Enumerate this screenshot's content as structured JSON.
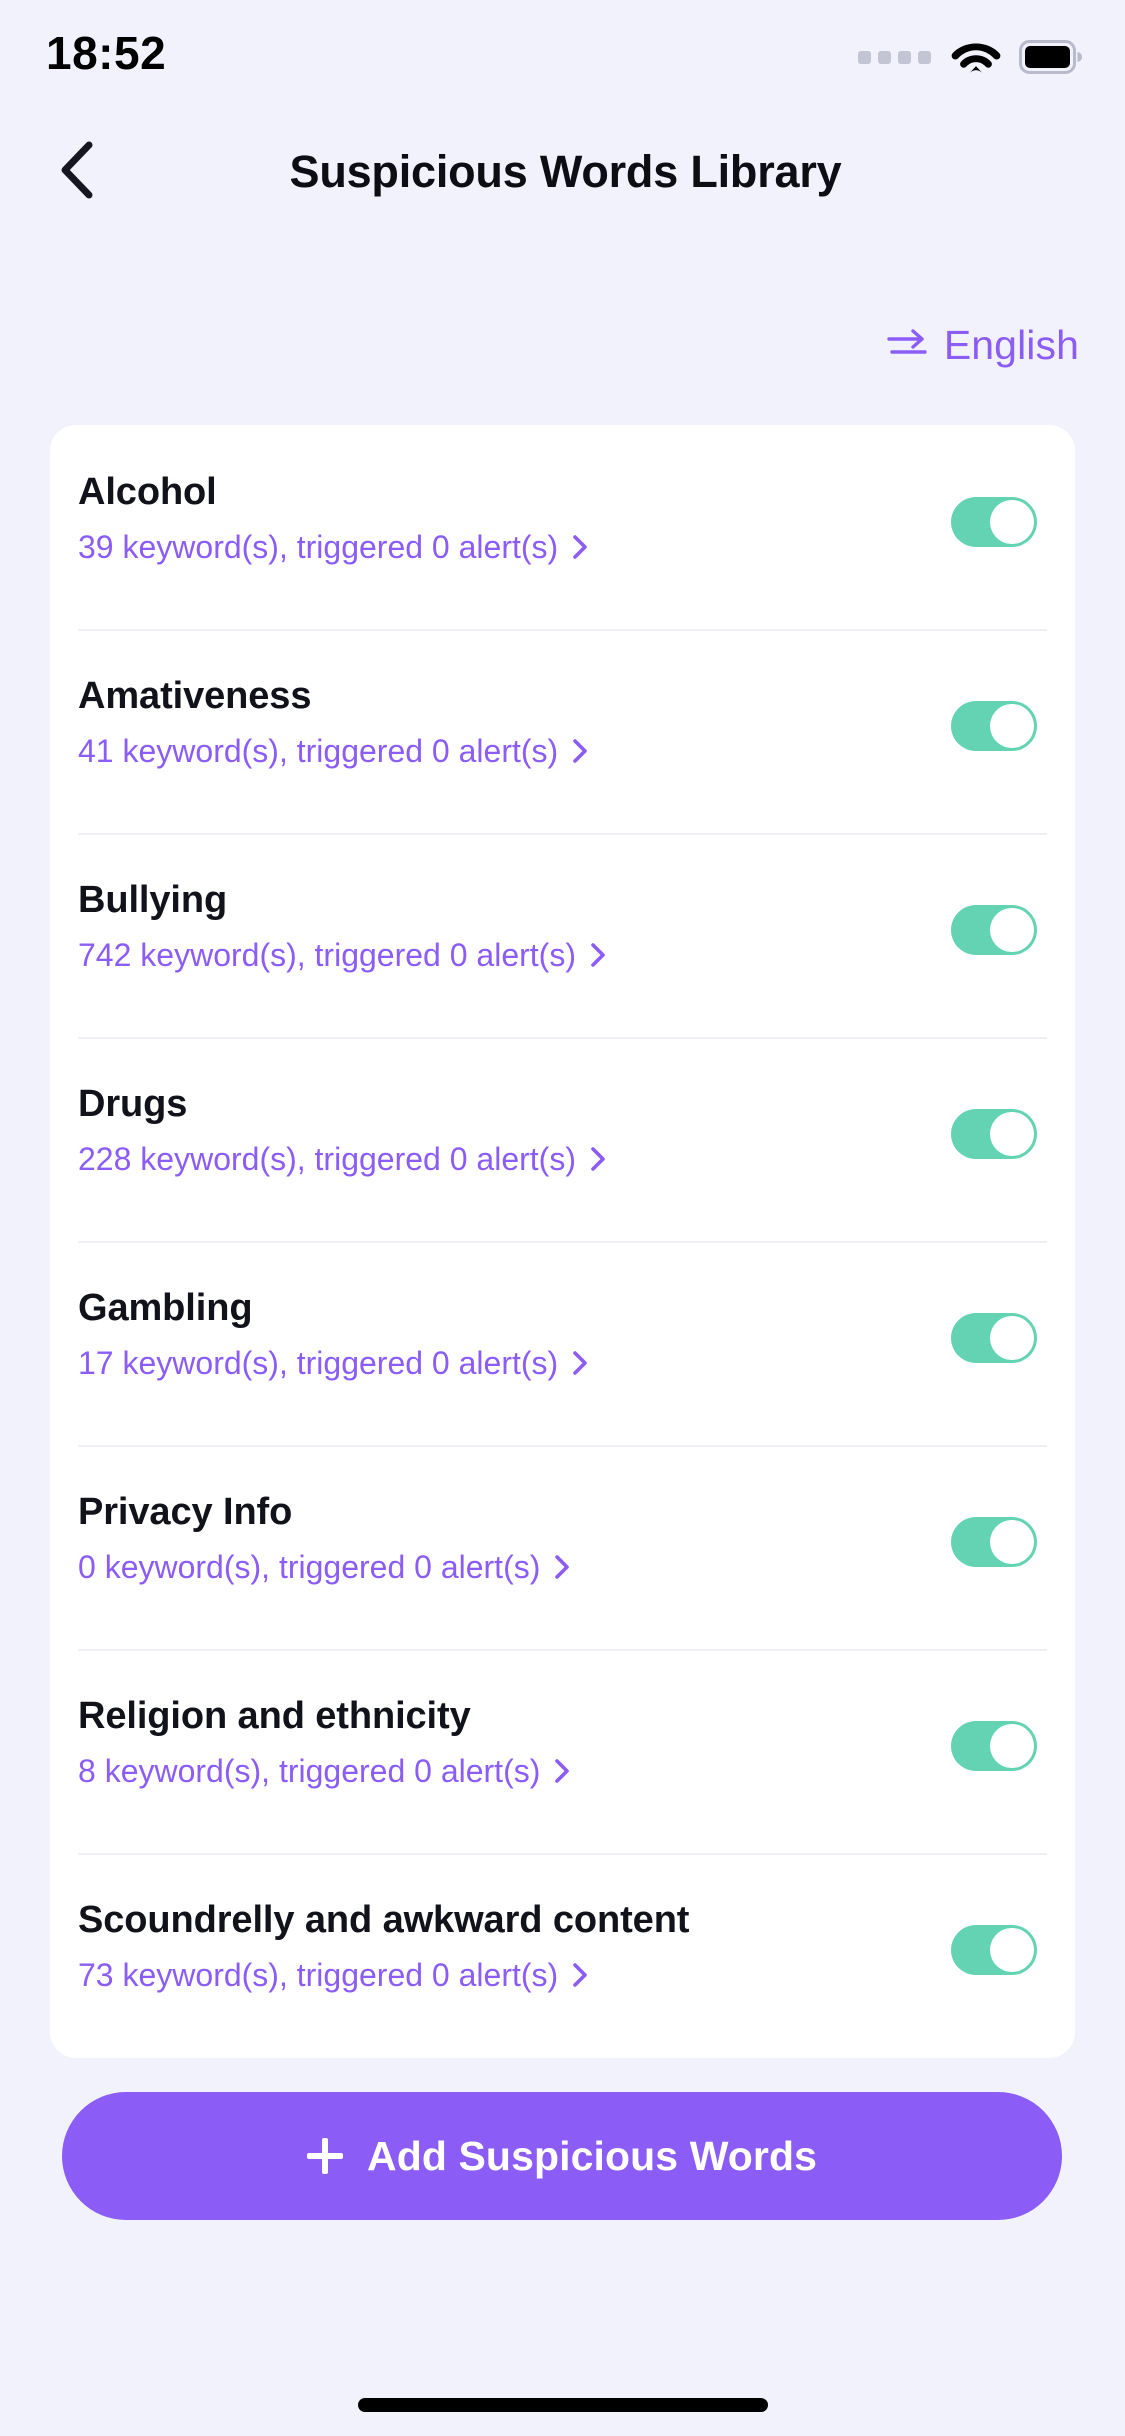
{
  "status_bar": {
    "time": "18:52",
    "signal_icon": "signal-dots-icon",
    "wifi_icon": "wifi-icon",
    "battery_icon": "battery-icon"
  },
  "header": {
    "back_icon": "chevron-left-icon",
    "title": "Suspicious Words Library"
  },
  "language_switcher": {
    "swap_icon": "swap-horizontal-icon",
    "label": "English"
  },
  "colors": {
    "background": "#f2f2fc",
    "card": "#ffffff",
    "accent_purple": "#8b5cf6",
    "toggle_on": "#63d3b4",
    "title_text": "#11121a",
    "divider": "#eeeef9"
  },
  "list": {
    "chevron_icon": "chevron-right-icon",
    "items": [
      {
        "title": "Alcohol",
        "subtitle": "39 keyword(s), triggered 0 alert(s)",
        "enabled": true
      },
      {
        "title": "Amativeness",
        "subtitle": "41 keyword(s), triggered 0 alert(s)",
        "enabled": true
      },
      {
        "title": "Bullying",
        "subtitle": "742 keyword(s), triggered 0 alert(s)",
        "enabled": true
      },
      {
        "title": "Drugs",
        "subtitle": "228 keyword(s), triggered 0 alert(s)",
        "enabled": true
      },
      {
        "title": "Gambling",
        "subtitle": "17 keyword(s), triggered 0 alert(s)",
        "enabled": true
      },
      {
        "title": "Privacy Info",
        "subtitle": "0 keyword(s), triggered 0 alert(s)",
        "enabled": true
      },
      {
        "title": "Religion and ethnicity",
        "subtitle": "8 keyword(s), triggered 0 alert(s)",
        "enabled": true
      },
      {
        "title": "Scoundrelly and awkward content",
        "subtitle": "73 keyword(s), triggered 0 alert(s)",
        "enabled": true
      }
    ]
  },
  "add_button": {
    "icon": "plus-icon",
    "label": "Add Suspicious Words"
  }
}
